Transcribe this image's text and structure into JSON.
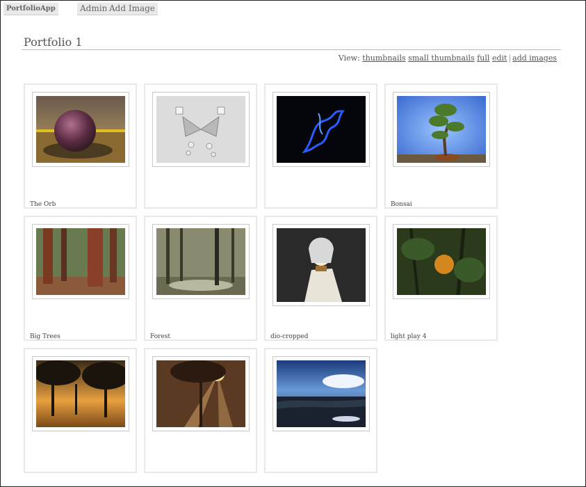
{
  "app": {
    "brand": "PortfolioApp",
    "nav": [
      "Admin",
      "Add Image"
    ]
  },
  "page": {
    "title": "Portfolio 1",
    "view_label": "View:",
    "view_links": [
      "thumbnails",
      "small thumbnails",
      "full",
      "edit",
      "add images"
    ]
  },
  "images": [
    {
      "caption": "The Orb"
    },
    {
      "caption": ""
    },
    {
      "caption": ""
    },
    {
      "caption": "Bonsai"
    },
    {
      "caption": "Big Trees"
    },
    {
      "caption": "Forest"
    },
    {
      "caption": "dio-cropped"
    },
    {
      "caption": "light play 4"
    },
    {
      "caption": ""
    },
    {
      "caption": ""
    },
    {
      "caption": ""
    }
  ]
}
